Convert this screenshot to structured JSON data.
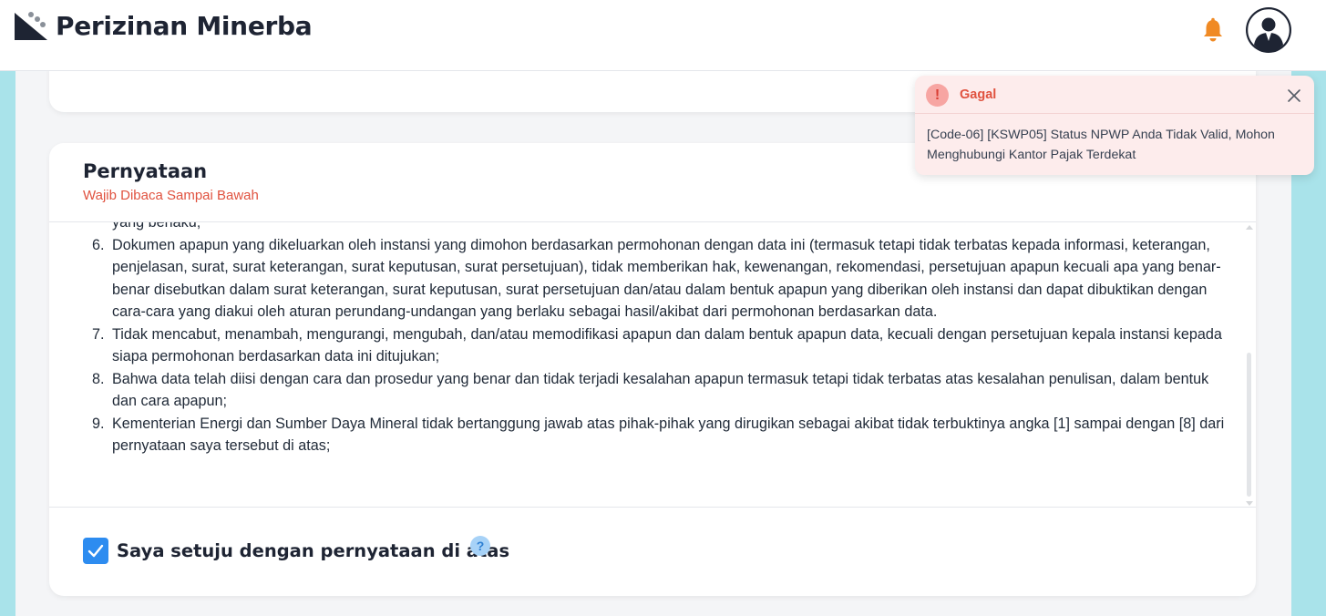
{
  "app": {
    "title": "Perizinan Minerba"
  },
  "header": {
    "bell_icon": "bell-icon",
    "avatar_icon": "user-avatar-icon"
  },
  "colors": {
    "bell": "#f08a24",
    "checkbox": "#2d8cf0",
    "error_text": "#e0523f",
    "toast_bg": "#fdecec",
    "band": "#a9e3ea"
  },
  "statement_card": {
    "title": "Pernyataan",
    "subtitle": "Wajib Dibaca Sampai Bawah",
    "items": [
      {
        "number": "",
        "text": "yang berlaku;"
      },
      {
        "number": "6.",
        "text": "Dokumen apapun yang dikeluarkan oleh instansi yang dimohon berdasarkan permohonan dengan data ini (termasuk tetapi tidak terbatas kepada informasi, keterangan, penjelasan, surat, surat keterangan, surat keputusan, surat persetujuan), tidak memberikan hak, kewenangan, rekomendasi, persetujuan apapun kecuali apa yang benar-benar disebutkan dalam surat keterangan, surat keputusan, surat persetujuan dan/atau dalam bentuk apapun yang diberikan oleh instansi dan dapat dibuktikan dengan cara-cara yang diakui oleh aturan perundang-undangan yang berlaku sebagai hasil/akibat dari permohonan berdasarkan data."
      },
      {
        "number": "7.",
        "text": "Tidak mencabut, menambah, mengurangi, mengubah, dan/atau memodifikasi apapun dan dalam bentuk apapun data, kecuali dengan persetujuan kepala instansi kepada siapa permohonan berdasarkan data ini ditujukan;"
      },
      {
        "number": "8.",
        "text": "Bahwa data telah diisi dengan cara dan prosedur yang benar dan tidak terjadi kesalahan apapun termasuk tetapi tidak terbatas atas kesalahan penulisan, dalam bentuk dan cara apapun;"
      },
      {
        "number": "9.",
        "text": "Kementerian Energi dan Sumber Daya Mineral tidak bertanggung jawab atas pihak-pihak yang dirugikan sebagai akibat tidak terbuktinya angka [1] sampai dengan [8] dari pernyataan saya tersebut di atas;"
      }
    ],
    "agree_label": "Saya setuju dengan pernyataan di atas",
    "agree_checked": true,
    "help_glyph": "?"
  },
  "toast": {
    "title": "Gagal",
    "alert_glyph": "!",
    "message": "[Code-06] [KSWP05] Status NPWP Anda Tidak Valid, Mohon Menghubungi Kantor Pajak Terdekat"
  }
}
